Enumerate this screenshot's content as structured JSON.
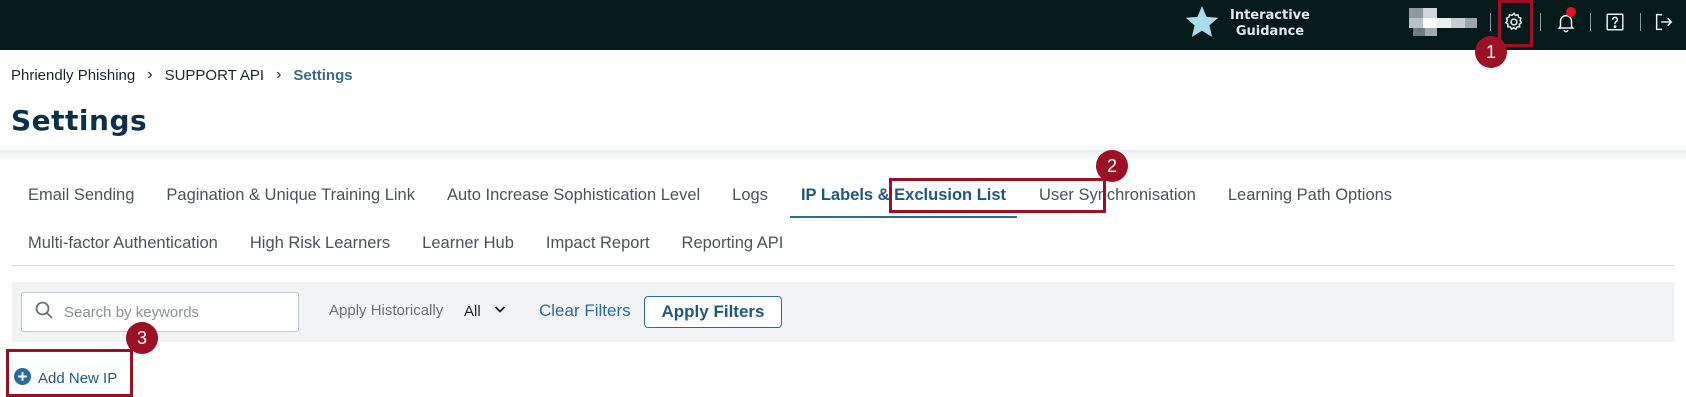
{
  "topbar": {
    "interactive_guidance_line1": "Interactive",
    "interactive_guidance_line2": "Guidance",
    "icons": [
      "star-icon",
      "user-avatar-pixelated",
      "gear-icon",
      "bell-icon",
      "help-icon",
      "logout-icon"
    ],
    "notification_dot_color": "#e0141e"
  },
  "breadcrumb": {
    "items": [
      "Phriendly Phishing",
      "SUPPORT API"
    ],
    "current": "Settings",
    "separator": "›"
  },
  "page": {
    "title": "Settings"
  },
  "tabs": {
    "row1": [
      "Email Sending",
      "Pagination & Unique Training Link",
      "Auto Increase Sophistication Level",
      "Logs",
      "IP Labels & Exclusion List",
      "User Synchronisation",
      "Learning Path Options"
    ],
    "row2": [
      "Multi-factor Authentication",
      "High Risk Learners",
      "Learner Hub",
      "Impact Report",
      "Reporting API"
    ],
    "active": "IP Labels & Exclusion List"
  },
  "filters": {
    "search_placeholder": "Search by keywords",
    "search_value": "",
    "apply_historically_label": "Apply Historically",
    "apply_historically_value": "All",
    "clear_filters": "Clear Filters",
    "apply_filters": "Apply Filters"
  },
  "actions": {
    "add_new_ip": "Add New IP"
  },
  "annotations": {
    "badges": [
      "1",
      "2",
      "3"
    ],
    "color": "#9b1025"
  },
  "colors": {
    "topbar_bg": "#061a1a",
    "accent": "#2a6aa1",
    "title": "#0c2f4a"
  }
}
